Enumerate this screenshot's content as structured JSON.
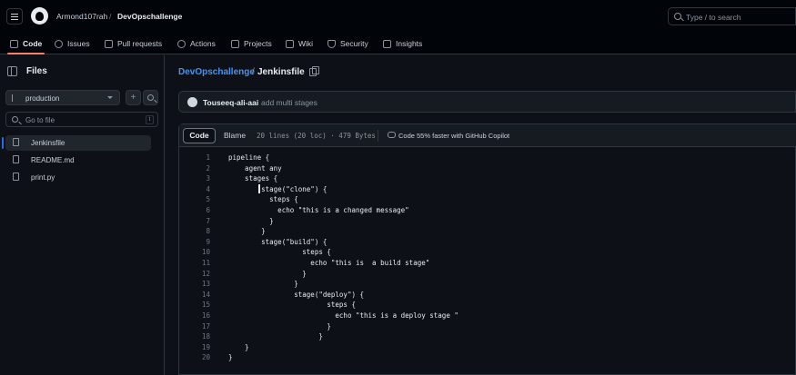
{
  "header": {
    "owner": "Armond107rah",
    "separator": "/",
    "repo": "DevOpschallenge",
    "search_placeholder": "Type / to search"
  },
  "nav": {
    "tabs": [
      {
        "label": "Code",
        "icon": "code-icon"
      },
      {
        "label": "Issues",
        "icon": "issue-icon"
      },
      {
        "label": "Pull requests",
        "icon": "pull-request-icon"
      },
      {
        "label": "Actions",
        "icon": "play-icon"
      },
      {
        "label": "Projects",
        "icon": "table-icon"
      },
      {
        "label": "Wiki",
        "icon": "book-icon"
      },
      {
        "label": "Security",
        "icon": "shield-icon"
      },
      {
        "label": "Insights",
        "icon": "graph-icon"
      }
    ]
  },
  "sidebar": {
    "title": "Files",
    "branch": "production",
    "add_label": "+",
    "goto_placeholder": "Go to file",
    "goto_shortcut": "t",
    "files": [
      {
        "name": "Jenkinsfile",
        "active": true
      },
      {
        "name": "README.md",
        "active": false
      },
      {
        "name": "print.py",
        "active": false
      }
    ]
  },
  "path": {
    "repo": "DevOpschallenge",
    "separator": "/",
    "file": "Jenkinsfile"
  },
  "commit": {
    "author": "Touseeq-ali-aai",
    "message": "add multi stages"
  },
  "file_view": {
    "code_tab": "Code",
    "blame_tab": "Blame",
    "meta": "20 lines (20 loc) · 479 Bytes",
    "copilot": "Code 55% faster with GitHub Copilot"
  },
  "code": {
    "lines": [
      "pipeline {",
      "    agent any",
      "    stages {",
      "        stage(\"clone\") {",
      "          steps {",
      "            echo \"this is a changed message\"",
      "          }",
      "        }",
      "        stage(\"build\") {",
      "                  steps {",
      "                    echo \"this is  a build stage\"",
      "                  }",
      "                }",
      "                stage(\"deploy\") {",
      "                        steps {",
      "                          echo \"this is a deploy stage \"",
      "                        }",
      "                      }",
      "    }",
      "}"
    ]
  },
  "colors": {
    "background": "#0d1117",
    "link": "#4493f8",
    "active_tab_underline": "#f78166",
    "active_file_marker": "#1f6feb"
  }
}
